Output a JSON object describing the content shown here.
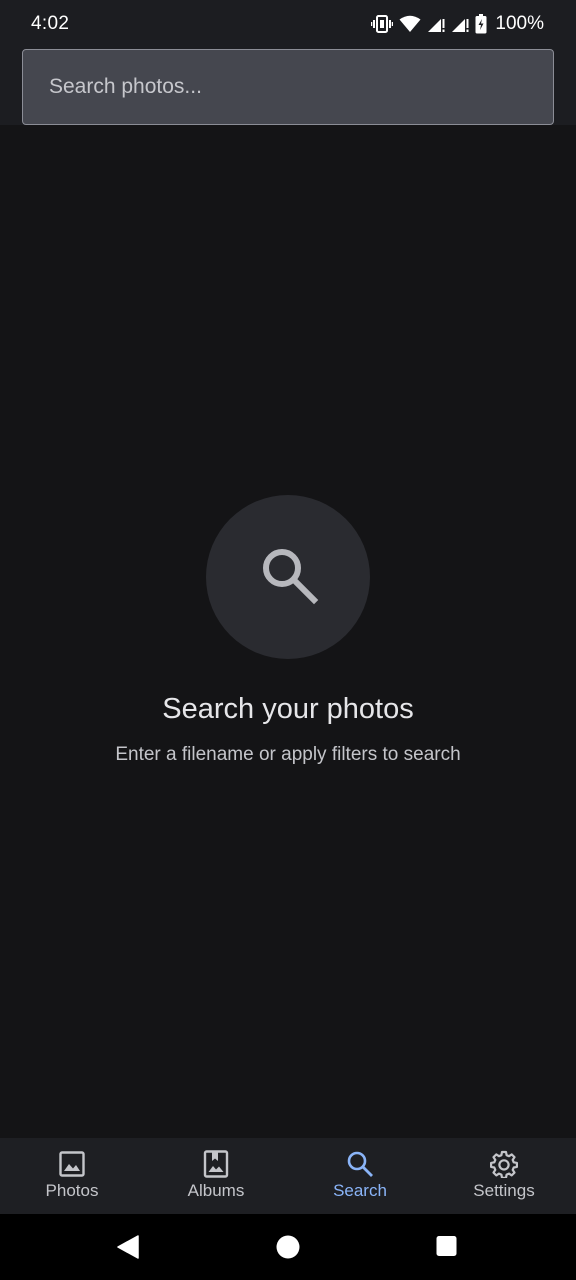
{
  "status_bar": {
    "time": "4:02",
    "battery": "100%",
    "icons": [
      "vibrate-icon",
      "wifi-icon",
      "signal-icon",
      "signal-icon",
      "battery-icon"
    ]
  },
  "search": {
    "placeholder": "Search photos..."
  },
  "empty_state": {
    "icon": "search-icon",
    "title": "Search your photos",
    "subtitle": "Enter a filename or apply filters to search"
  },
  "bottom_nav": {
    "items": [
      {
        "label": "Photos",
        "icon": "photo-icon",
        "active": false
      },
      {
        "label": "Albums",
        "icon": "album-icon",
        "active": false
      },
      {
        "label": "Search",
        "icon": "search-icon",
        "active": true
      },
      {
        "label": "Settings",
        "icon": "gear-icon",
        "active": false
      }
    ]
  },
  "system_nav": {
    "buttons": [
      "back-icon",
      "home-icon",
      "recents-icon"
    ]
  },
  "colors": {
    "background": "#141416",
    "header": "#1c1d21",
    "accent": "#8ab4f8",
    "input_fill": "#45474f"
  }
}
